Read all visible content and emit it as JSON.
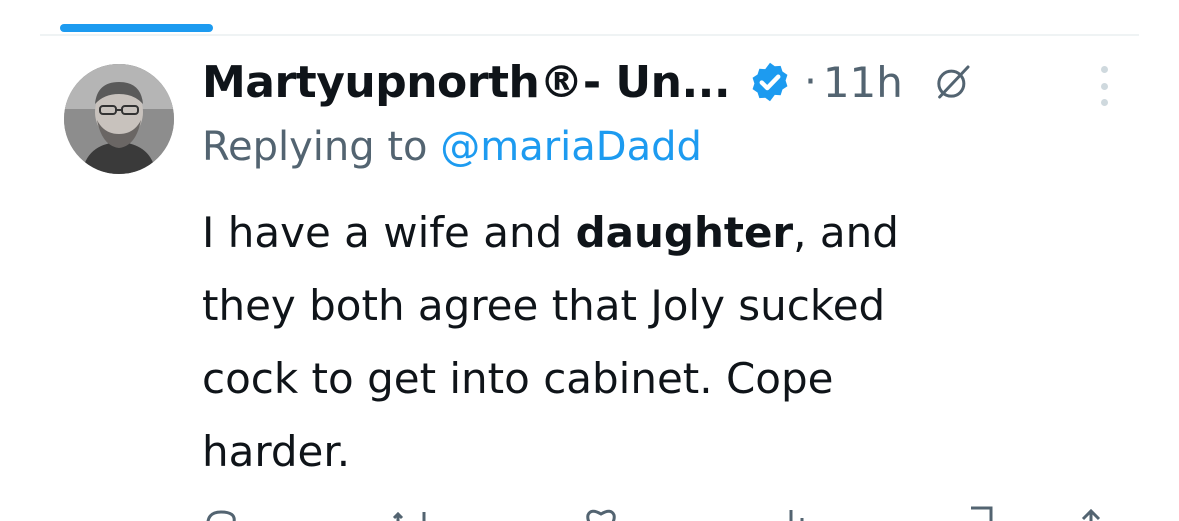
{
  "colors": {
    "accent": "#1d9bf0",
    "text_primary": "#0f1419",
    "text_secondary": "#536471",
    "divider": "#eff3f4"
  },
  "tweet": {
    "display_name": "Martyupnorth®- Un...",
    "separator": "·",
    "timestamp": "11h",
    "reply_prefix": "Replying to",
    "reply_handle": "@mariaDadd",
    "text_lines": {
      "l1_a": "I have a wife and ",
      "l1_bold": "daughter",
      "l1_b": ", and",
      "l2": "they both agree that Joly sucked",
      "l3": "cock to get into cabinet.  Cope",
      "l4": "harder."
    },
    "icons": {
      "avatar": "avatar-photo",
      "verified": "verified-badge-icon",
      "grok": "grok-icon",
      "more": "more-icon",
      "actions": [
        "reply-icon",
        "retweet-icon",
        "like-icon",
        "views-icon",
        "bookmark-icon",
        "share-icon"
      ]
    }
  }
}
